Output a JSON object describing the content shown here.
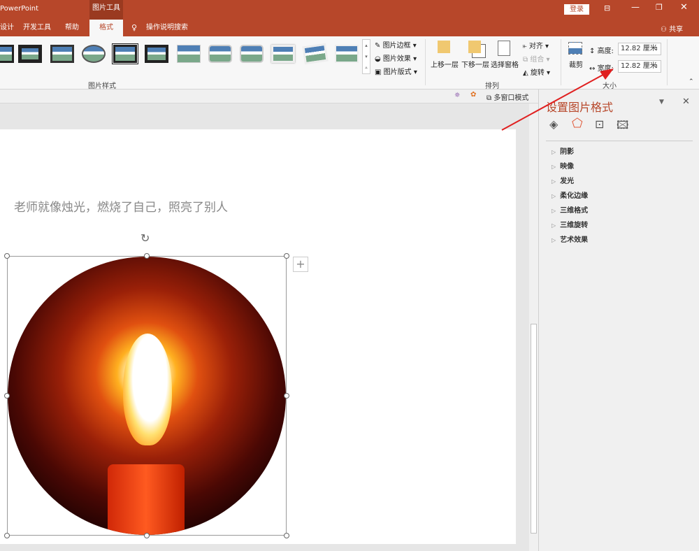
{
  "titlebar": {
    "app": "PowerPoint",
    "context_tab": "图片工具",
    "login": "登录",
    "share": "共享"
  },
  "tabs": [
    "设计",
    "开发工具",
    "帮助",
    "格式"
  ],
  "active_tab": "格式",
  "search": "操作说明搜索",
  "ribbon": {
    "picture_styles_label": "图片样式",
    "picture_border": "图片边框",
    "picture_effects": "图片效果",
    "picture_layout": "图片版式",
    "arrange_label": "排列",
    "bring_forward": "上移一层",
    "send_backward": "下移一层",
    "selection_pane": "选择窗格",
    "align": "对齐",
    "group": "组合",
    "rotate": "旋转",
    "crop": "裁剪",
    "size_label": "大小",
    "height_label": "高度:",
    "height_value": "12.82 厘米",
    "width_label": "宽度:",
    "width_value": "12.82 厘米"
  },
  "strip": {
    "multi_window": "多窗口模式"
  },
  "slide": {
    "text": "老师就像烛光，燃烧了自己，照亮了别人"
  },
  "pane": {
    "title": "设置图片格式",
    "items": [
      "阴影",
      "映像",
      "发光",
      "柔化边缘",
      "三维格式",
      "三维旋转",
      "艺术效果"
    ]
  },
  "colors": {
    "accent": "#b7472a",
    "arrow": "#e02020"
  }
}
